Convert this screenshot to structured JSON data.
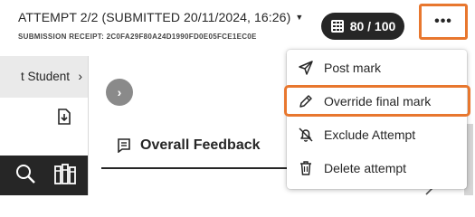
{
  "header": {
    "attempt_title": "ATTEMPT 2/2 (SUBMITTED 20/11/2024, 16:26)",
    "receipt": "SUBMISSION RECEIPT: 2C0FA29F80A24D1990FD0E05FCE1EC0E",
    "grade": "80 / 100",
    "more_label": "•••"
  },
  "left_panel": {
    "student_label": "t Student",
    "chevron": "›"
  },
  "content": {
    "nav_arrow": "›",
    "feedback_tab": "Overall Feedback"
  },
  "menu": {
    "items": [
      {
        "label": "Post mark",
        "icon": "send-icon"
      },
      {
        "label": "Override final mark",
        "icon": "pencil-icon"
      },
      {
        "label": "Exclude Attempt",
        "icon": "bell-off-icon"
      },
      {
        "label": "Delete attempt",
        "icon": "trash-icon"
      }
    ]
  },
  "colors": {
    "highlight": "#e8772e",
    "dark": "#262626"
  }
}
